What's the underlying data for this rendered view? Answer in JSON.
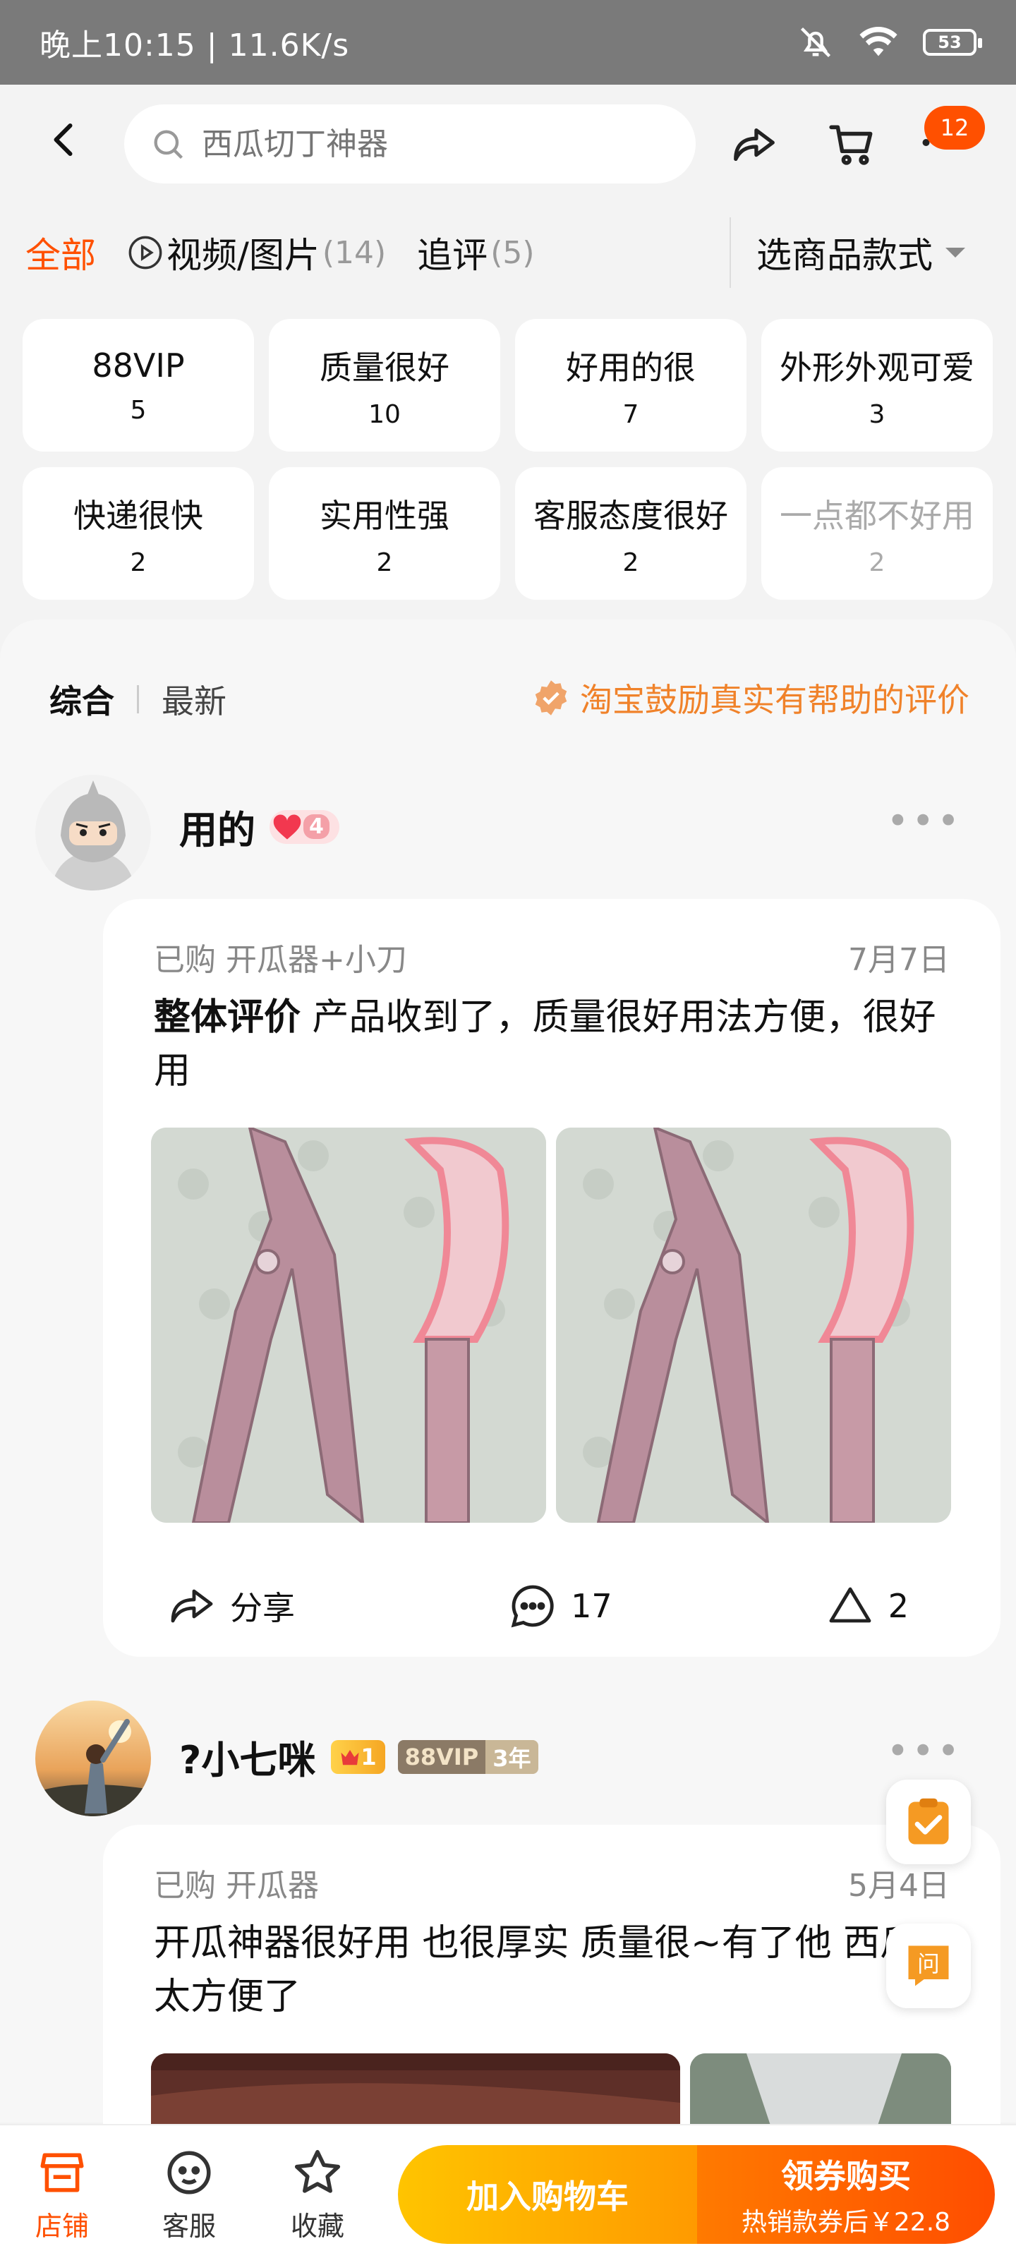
{
  "status_bar": {
    "time_speed": "晚上10:15 | 11.6K/s",
    "battery": "53"
  },
  "header": {
    "search_placeholder": "西瓜切丁神器",
    "cart_badge": "12"
  },
  "filters": {
    "all": "全部",
    "video_label": "视频/图片",
    "video_count": "(14)",
    "followup_label": "追评",
    "followup_count": "(5)",
    "style_select": "选商品款式"
  },
  "tags": [
    {
      "label": "88VIP",
      "count": "5"
    },
    {
      "label": "质量很好",
      "count": "10"
    },
    {
      "label": "好用的很",
      "count": "7"
    },
    {
      "label": "外形外观可爱",
      "count": "3"
    },
    {
      "label": "快递很快",
      "count": "2"
    },
    {
      "label": "实用性强",
      "count": "2"
    },
    {
      "label": "客服态度很好",
      "count": "2"
    },
    {
      "label": "一点都不好用",
      "count": "2"
    }
  ],
  "sort": {
    "overall": "综合",
    "latest": "最新",
    "encourage": "淘宝鼓励真实有帮助的评价"
  },
  "reviews": [
    {
      "username": "用的",
      "level": "4",
      "purchased": "已购  开瓜器+小刀",
      "date": "7月7日",
      "text_prefix": "整体评价",
      "text": " 产品收到了，质量很好用法方便，很好用",
      "share": "分享",
      "comments": "17",
      "likes": "2"
    },
    {
      "username": "?小七咪",
      "level": "1",
      "vip": "88VIP",
      "vip_years": "3年",
      "purchased": "已购  开瓜器",
      "date": "5月4日",
      "text": "开瓜神器很好用 也很厚实 质量很~有了他 西瓜太方便了"
    }
  ],
  "bottom_bar": {
    "store": "店铺",
    "service": "客服",
    "favorite": "收藏",
    "add_cart": "加入购物车",
    "buy_title": "领券购买",
    "buy_sub": "热销款券后￥22.8"
  },
  "colors": {
    "accent": "#ff5000",
    "encourage": "#f0822a"
  }
}
